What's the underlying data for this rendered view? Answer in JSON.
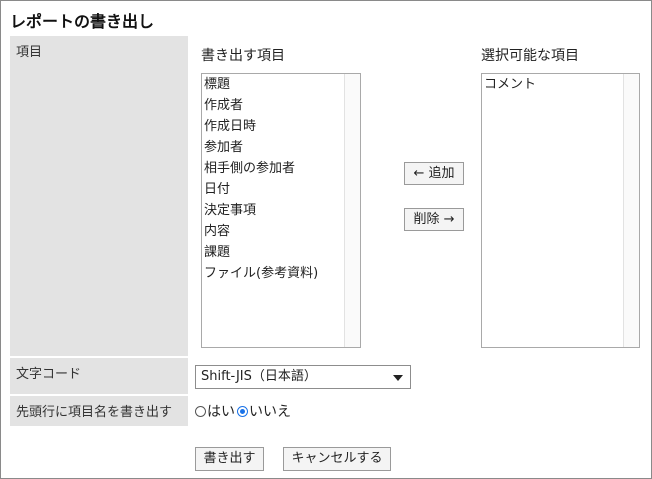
{
  "title": "レポートの書き出し",
  "labels": {
    "items": "項目",
    "charset": "文字コード",
    "header_row": "先頭行に項目名を書き出す"
  },
  "export_list": {
    "header": "書き出す項目",
    "items": [
      "標題",
      "作成者",
      "作成日時",
      "参加者",
      "相手側の参加者",
      "日付",
      "決定事項",
      "内容",
      "課題",
      "ファイル(参考資料)"
    ]
  },
  "available_list": {
    "header": "選択可能な項目",
    "items": [
      "コメント"
    ]
  },
  "buttons": {
    "add": "← 追加",
    "remove": "削除 →",
    "export": "書き出す",
    "cancel": "キャンセルする"
  },
  "charset_select": {
    "selected": "Shift-JIS（日本語）"
  },
  "header_row_options": {
    "yes": "はい",
    "no": "いいえ",
    "selected": "no"
  },
  "colors": {
    "label_bg": "#e3e3e3",
    "radio_accent": "#1a73e8"
  }
}
